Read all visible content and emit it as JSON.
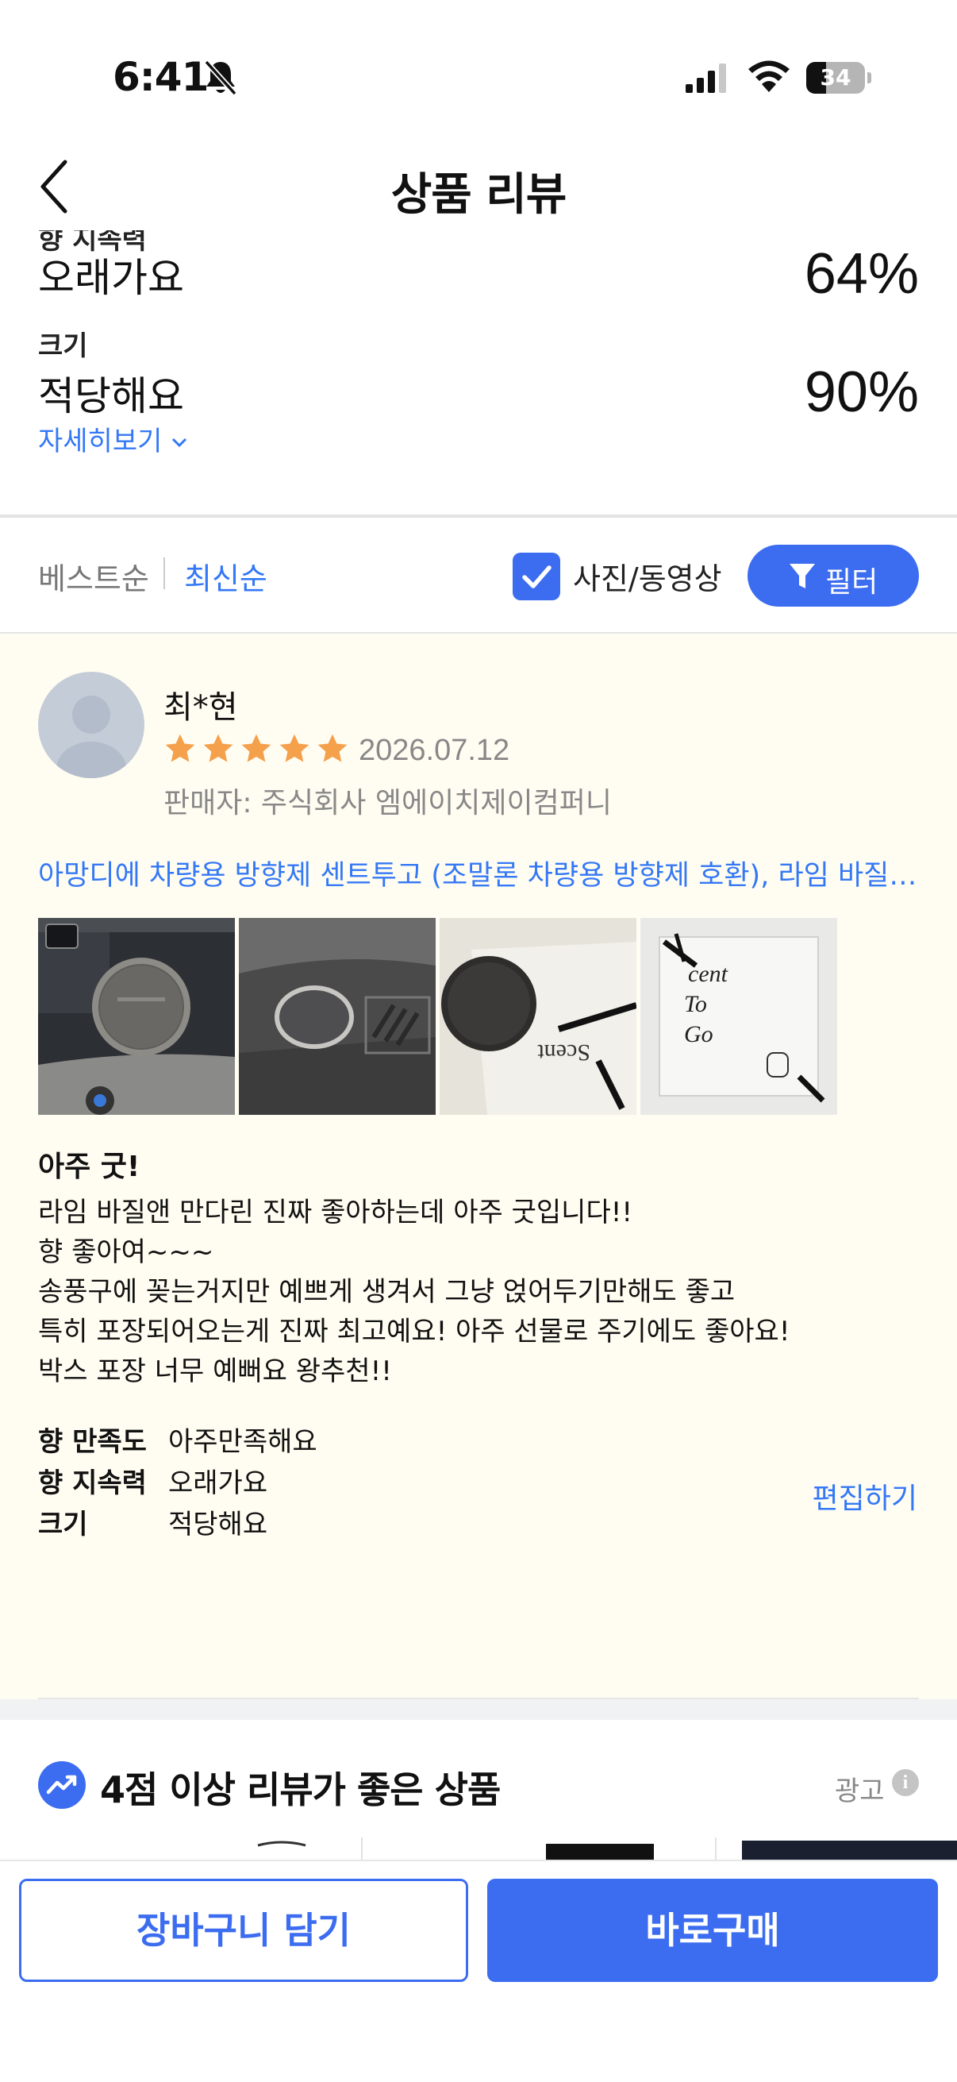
{
  "status_bar": {
    "time": "6:41",
    "battery": "34",
    "battery_level": 0.34
  },
  "header": {
    "title": "상품 리뷰"
  },
  "summary": {
    "partial_label": "향 지속력",
    "rows": [
      {
        "label": "",
        "value": "오래가요",
        "percent": "64%"
      },
      {
        "label": "크기",
        "value": "적당해요",
        "percent": "90%"
      }
    ],
    "more_link": "자세히보기"
  },
  "sort": {
    "best": "베스트순",
    "newest": "최신순",
    "photo_filter": "사진/동영상",
    "photo_filter_checked": true,
    "filter_button": "필터"
  },
  "review": {
    "reviewer": "최*현",
    "rating": 5,
    "date": "2026.07.12",
    "seller": "판매자: 주식회사 엠에이치제이컴퍼니",
    "product_link": "아망디에 차량용 방향제 센트투고 (조말론 차량용 방향제 호환), 라임 바질 앤 만다린",
    "photo_text": "Scent To Go",
    "title": "아주 굿!",
    "body": [
      "라임 바질앤 만다린 진짜 좋아하는데 아주 굿입니다!!",
      "향 좋아여~~~",
      "송풍구에 꽂는거지만 예쁘게 생겨서 그냥 얹어두기만해도 좋고",
      "특히 포장되어오는게 진짜 최고예요! 아주 선물로 주기에도 좋아요!",
      "박스 포장 너무 예뻐요 왕추천!!"
    ],
    "attributes": [
      {
        "label": "향 만족도",
        "value": "아주만족해요"
      },
      {
        "label": "향 지속력",
        "value": "오래가요"
      },
      {
        "label": "크기",
        "value": "적당해요"
      }
    ],
    "edit_link": "편집하기"
  },
  "recommend": {
    "title": "4점 이상 리뷰가 좋은 상품",
    "ad_label": "광고",
    "info_glyph": "i"
  },
  "bottom": {
    "cart": "장바구니 담기",
    "buy": "바로구매"
  },
  "colors": {
    "accent": "#3c6df0",
    "link": "#3478f6",
    "star": "#f5a04a",
    "review_bg": "#fffdf2"
  }
}
